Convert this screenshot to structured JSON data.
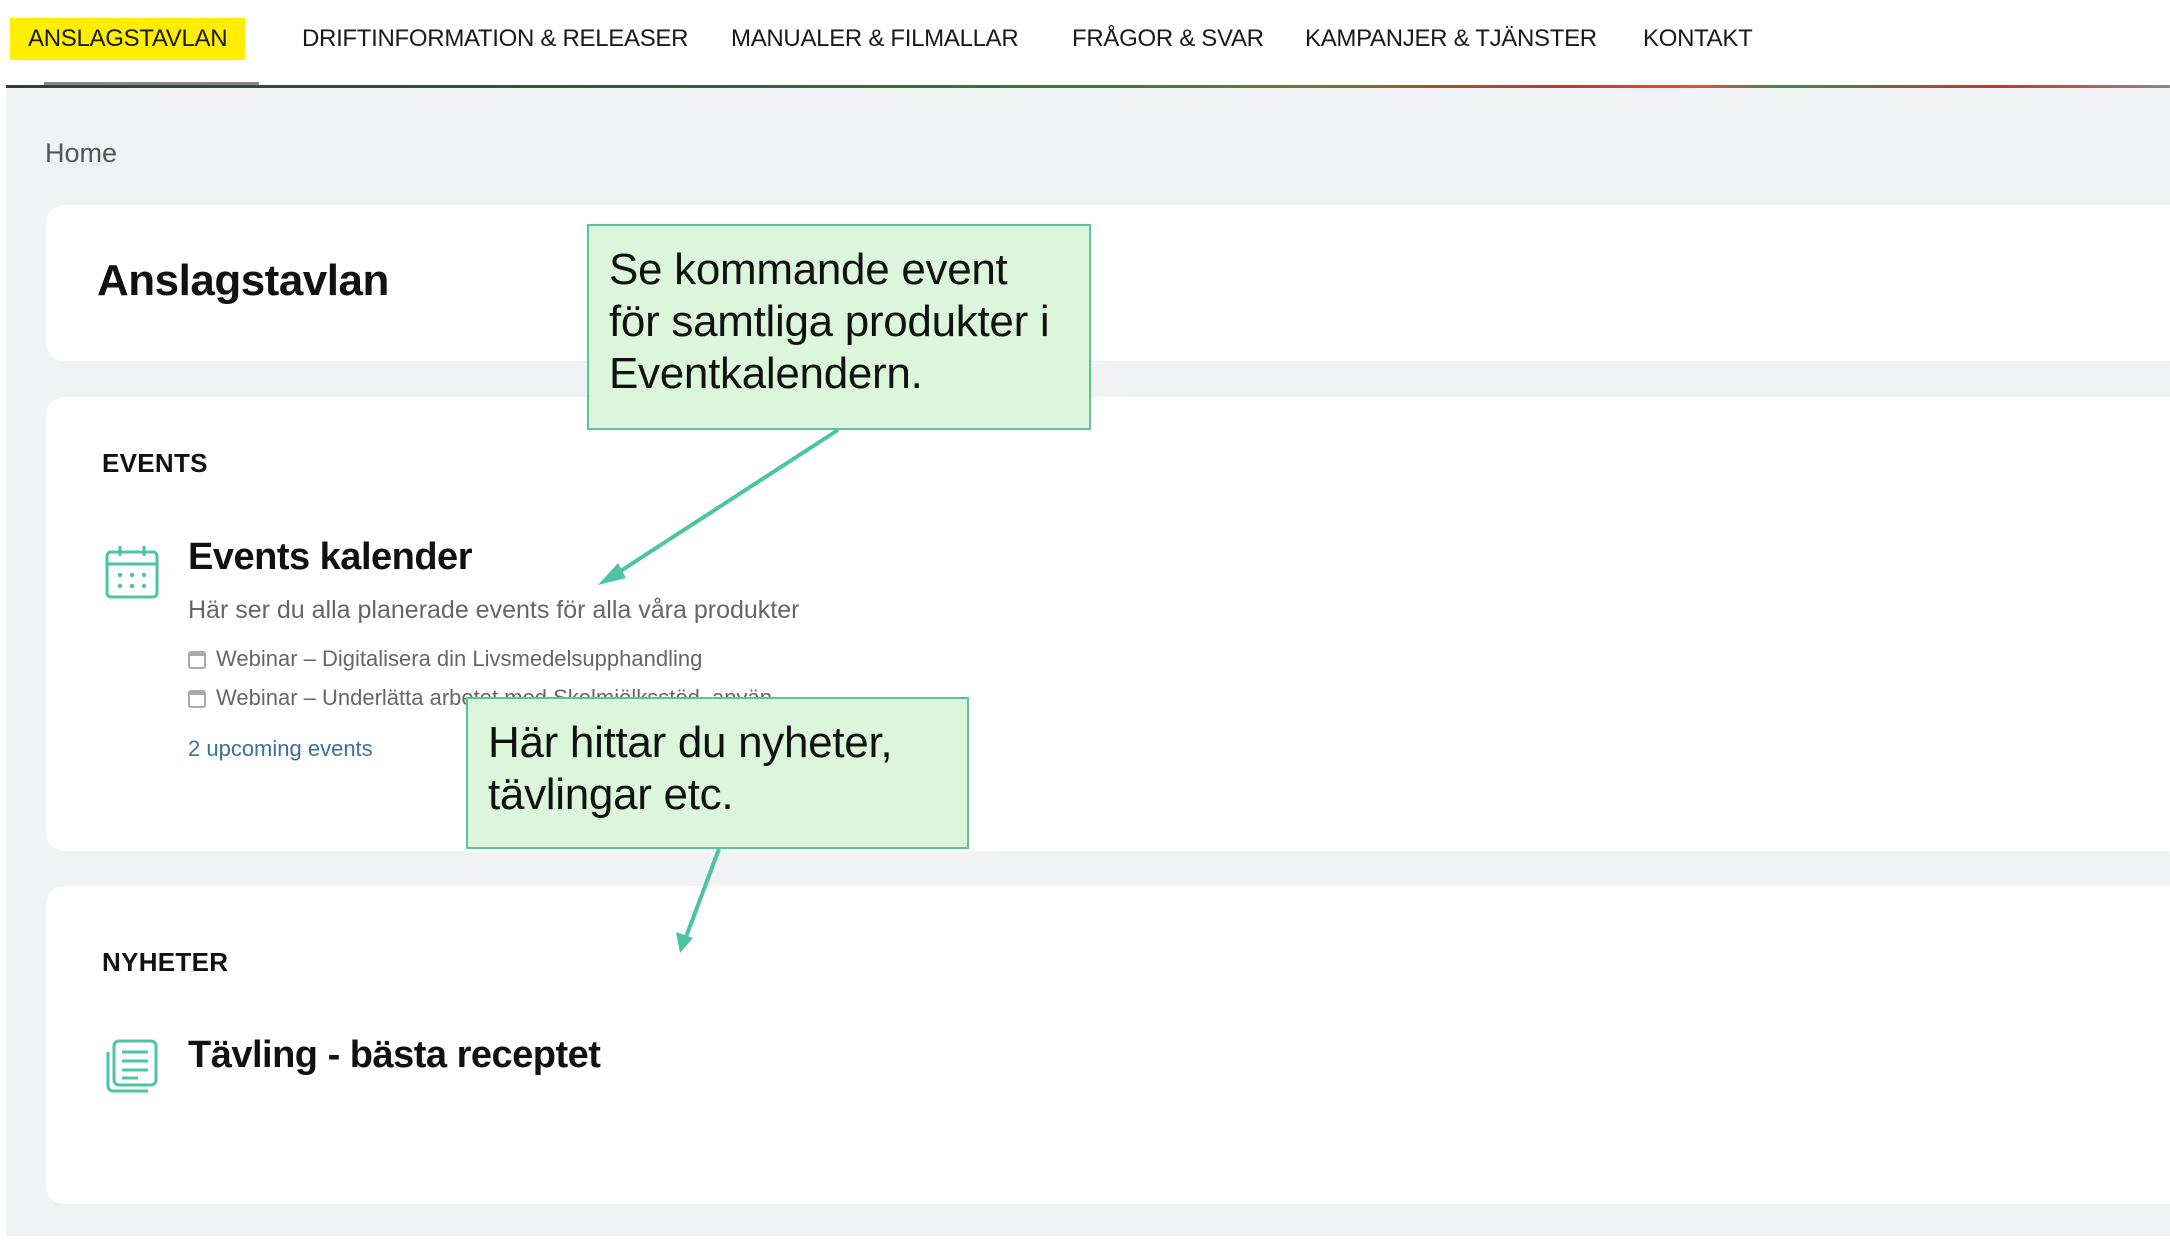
{
  "nav": {
    "items": [
      {
        "label": "ANSLAGSTAVLAN",
        "active": true
      },
      {
        "label": "DRIFTINFORMATION & RELEASER"
      },
      {
        "label": "MANUALER & FILMALLAR"
      },
      {
        "label": "FRÅGOR & SVAR"
      },
      {
        "label": "KAMPANJER & TJÄNSTER"
      },
      {
        "label": "KONTAKT"
      }
    ],
    "active_color": "#ffee00"
  },
  "breadcrumb": "Home",
  "page_title": "Anslagstavlan",
  "events": {
    "section_label": "EVENTS",
    "icon": "calendar-icon",
    "title": "Events kalender",
    "description": "Här ser du alla planerade events för alla våra produkter",
    "items": [
      "Webinar – Digitalisera din Livsmedelsupphandling",
      "Webinar – Underlätta arbetet med Skolmjölksstöd, använ"
    ],
    "upcoming_link": "2 upcoming events"
  },
  "news": {
    "section_label": "NYHETER",
    "icon": "document-icon",
    "title": "Tävling - bästa receptet"
  },
  "callouts": [
    {
      "text": "Se kommande event för samtliga produkter i Eventkalendern."
    },
    {
      "text": "Här hittar du nyheter, tävlingar etc."
    }
  ],
  "colors": {
    "accent_icon": "#4cc4a4",
    "callout_bg": "#dcf6dc",
    "callout_border": "#5bc29a",
    "arrow": "#4cc4a4"
  }
}
